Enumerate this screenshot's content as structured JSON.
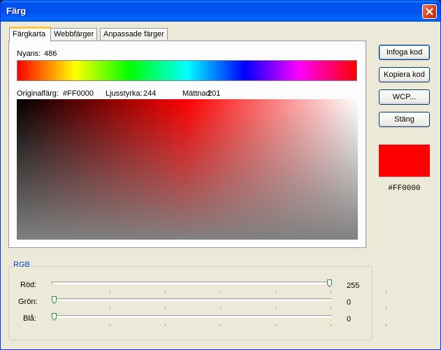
{
  "window": {
    "title": "Färg"
  },
  "tabs": [
    {
      "label": "Färgkarta",
      "active": true
    },
    {
      "label": "Webbfärger",
      "active": false
    },
    {
      "label": "Anpassade färger",
      "active": false
    }
  ],
  "hue": {
    "label": "Nyans:",
    "value": "486"
  },
  "info": {
    "original_label": "Originalfärg:",
    "original_value": "#FF0000",
    "brightness_label": "Ljusstyrka:",
    "brightness_value": "244",
    "saturation_label": "Mättnad:",
    "saturation_value": "201"
  },
  "buttons": {
    "insert": "Infoga kod",
    "copy": "Kopiera kod",
    "wcp": "WCP...",
    "close": "Stäng"
  },
  "preview": {
    "color": "#FF0000",
    "hex": "#FF0000"
  },
  "rgb": {
    "legend": "RGB",
    "max": 255,
    "sliders": [
      {
        "label": "Röd:",
        "value": "255"
      },
      {
        "label": "Grön:",
        "value": "0"
      },
      {
        "label": "Blå:",
        "value": "0"
      }
    ]
  }
}
